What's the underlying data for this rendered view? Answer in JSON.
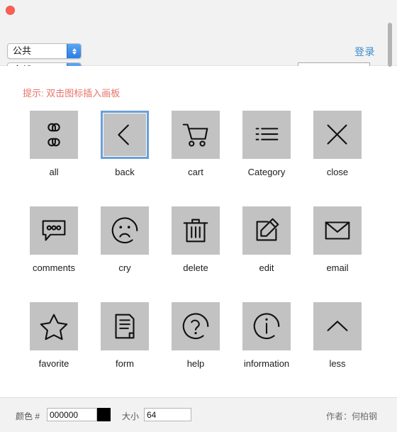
{
  "window": {
    "close_button": "close-window"
  },
  "header": {
    "scope_select": {
      "value": "公共",
      "name": "scope-select"
    },
    "filter_select": {
      "value": "全部",
      "name": "filter-select"
    },
    "login_label": "登录",
    "search": {
      "value": "",
      "placeholder": ""
    }
  },
  "content": {
    "hint": "提示: 双击图标插入画板",
    "icons": [
      {
        "label": "all",
        "icon": "all-icon",
        "selected": false
      },
      {
        "label": "back",
        "icon": "back-icon",
        "selected": true
      },
      {
        "label": "cart",
        "icon": "cart-icon",
        "selected": false
      },
      {
        "label": "Category",
        "icon": "category-icon",
        "selected": false
      },
      {
        "label": "close",
        "icon": "close-icon",
        "selected": false
      },
      {
        "label": "comments",
        "icon": "comments-icon",
        "selected": false
      },
      {
        "label": "cry",
        "icon": "cry-icon",
        "selected": false
      },
      {
        "label": "delete",
        "icon": "delete-icon",
        "selected": false
      },
      {
        "label": "edit",
        "icon": "edit-icon",
        "selected": false
      },
      {
        "label": "email",
        "icon": "email-icon",
        "selected": false
      },
      {
        "label": "favorite",
        "icon": "favorite-icon",
        "selected": false
      },
      {
        "label": "form",
        "icon": "form-icon",
        "selected": false
      },
      {
        "label": "help",
        "icon": "help-icon",
        "selected": false
      },
      {
        "label": "information",
        "icon": "information-icon",
        "selected": false
      },
      {
        "label": "less",
        "icon": "less-icon",
        "selected": false
      }
    ]
  },
  "footer": {
    "color_label": "颜色 #",
    "color_value": "000000",
    "color_swatch": "#000000",
    "size_label": "大小",
    "size_value": "64",
    "author": "作者：何柏钢"
  },
  "colors": {
    "accent_link": "#3b8ccc",
    "hint_red": "#e8736a",
    "tile_bg": "#c2c2c2",
    "selection_border": "#6a9fd8",
    "chrome_bg": "#f2f2f2"
  }
}
